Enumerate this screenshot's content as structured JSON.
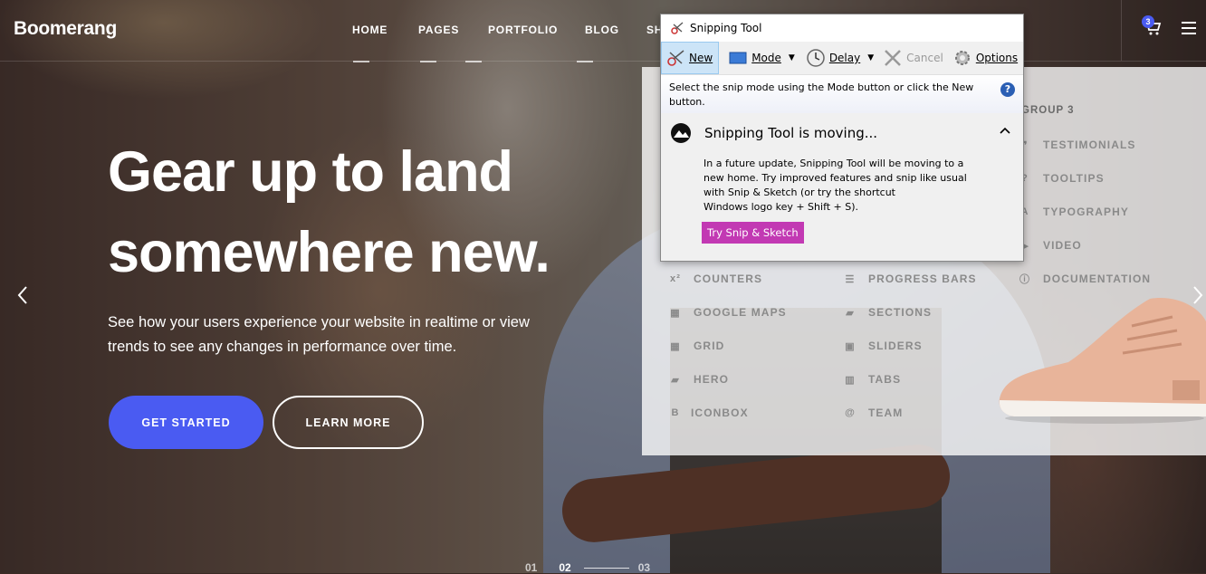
{
  "header": {
    "logo": "Boomerang",
    "nav": [
      "HOME",
      "PAGES",
      "PORTFOLIO",
      "BLOG",
      "SH"
    ],
    "cart_count": "3",
    "icons": {
      "cart": "cart-icon",
      "menu": "hamburger-menu-icon"
    }
  },
  "hero": {
    "title_line1": "Gear up to land",
    "title_line2": "somewhere new.",
    "description_line1": "See how your users experience your website in realtime or view",
    "description_line2": "trends to see any changes in performance over time.",
    "primary_button": "GET STARTED",
    "secondary_button": "LEARN MORE",
    "accent_color": "#4a5bf2"
  },
  "slider": {
    "items": [
      "01",
      "02",
      "03"
    ],
    "active": "02"
  },
  "mega_menu": {
    "group3_heading": "GROUP 3",
    "col1": [
      "COUNTERS",
      "GOOGLE MAPS",
      "GRID",
      "HERO",
      "ICONBOX"
    ],
    "col2": [
      "PROGRESS BARS",
      "SECTIONS",
      "SLIDERS",
      "TABS",
      "TEAM"
    ],
    "col3": [
      "TESTIMONIALS",
      "TOOLTIPS",
      "TYPOGRAPHY",
      "VIDEO",
      "DOCUMENTATION"
    ],
    "col1_icons": [
      "x²",
      "map",
      "grid",
      "chat",
      "B"
    ],
    "col2_icons": [
      "list",
      "sections",
      "sliders",
      "tabs",
      "@"
    ],
    "col3_icons": [
      "quote",
      "?",
      "A",
      "video",
      "info"
    ]
  },
  "snipping_tool": {
    "title": "Snipping Tool",
    "toolbar": {
      "new": "New",
      "mode": "Mode",
      "delay": "Delay",
      "cancel": "Cancel",
      "options": "Options"
    },
    "info": "Select the snip mode using the Mode button or click the New button.",
    "notice_title": "Snipping Tool is moving...",
    "notice_body_1": "In a future update, Snipping Tool will be moving to a new home. Try improved features and snip like usual with Snip & Sketch (or try the shortcut",
    "notice_body_2": "Windows logo key + Shift + S).",
    "notice_button": "Try Snip & Sketch",
    "button_color": "#c239b3"
  }
}
